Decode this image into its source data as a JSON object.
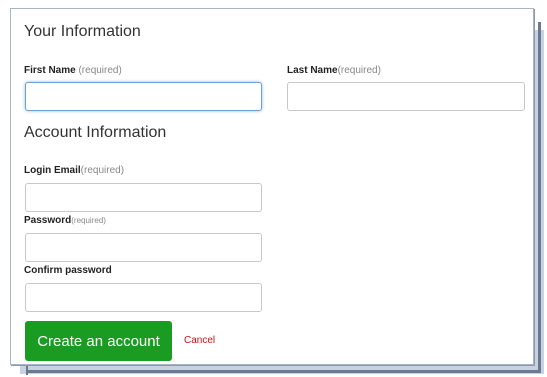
{
  "your_info": {
    "heading": "Your Information",
    "first_name_label": "First Name",
    "first_name_req": " (required)",
    "first_name_value": "",
    "last_name_label": "Last Name",
    "last_name_req": "(required)",
    "last_name_value": ""
  },
  "account_info": {
    "heading": "Account Information",
    "email_label": "Login Email",
    "email_req": "(required)",
    "email_value": "",
    "password_label": "Password",
    "password_req": "(required)",
    "password_value": "",
    "confirm_label": "Confirm password",
    "confirm_value": ""
  },
  "actions": {
    "create_label": "Create an account",
    "cancel_label": "Cancel"
  },
  "colors": {
    "primary_button": "#1a9b22",
    "cancel_link": "#cc1111",
    "focus_border": "#66a3d9"
  }
}
